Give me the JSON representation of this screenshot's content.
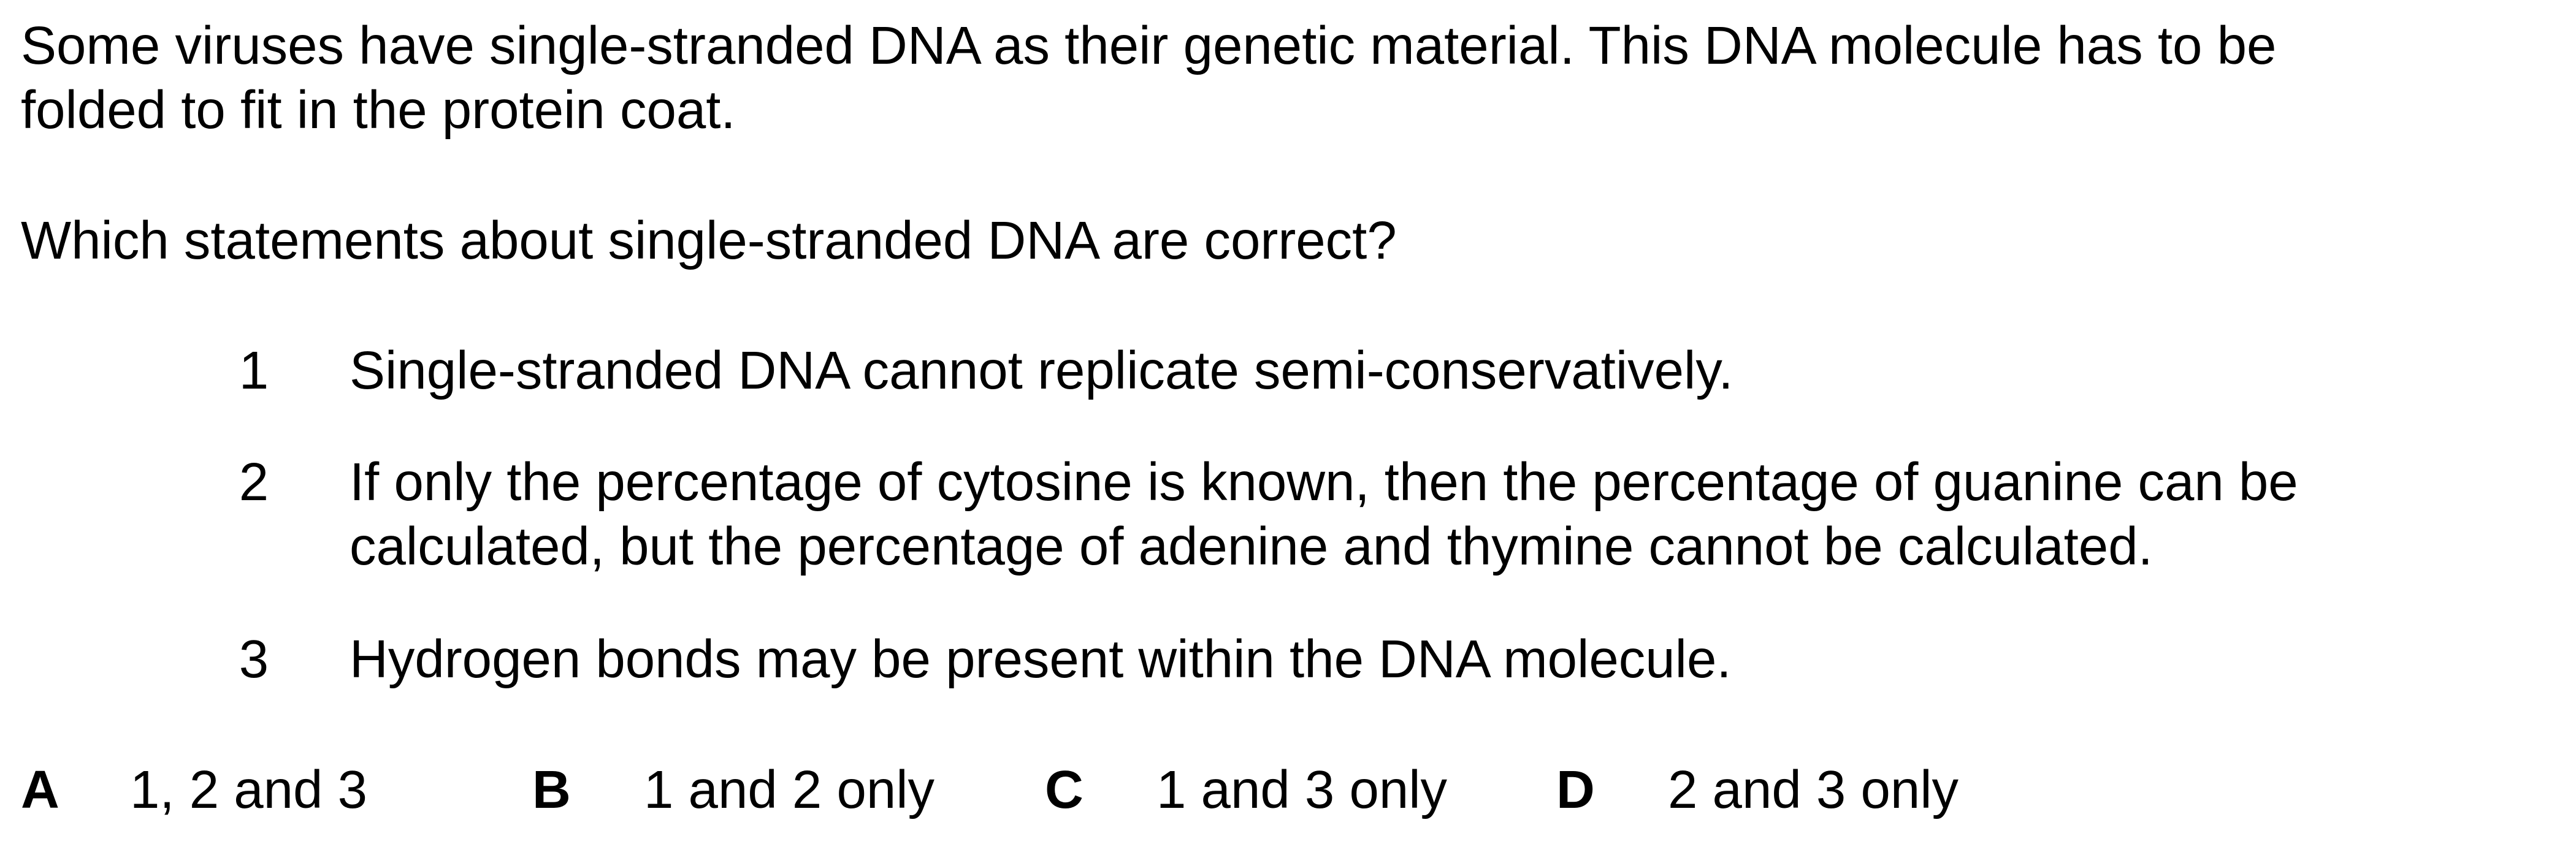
{
  "intro": {
    "line1": "Some viruses have single-stranded DNA as their genetic material. This DNA molecule has to be",
    "line2": "folded to fit in the protein coat."
  },
  "question": "Which statements about single-stranded DNA are correct?",
  "statements": [
    {
      "number": "1",
      "lines": [
        "Single-stranded DNA cannot replicate semi-conservatively."
      ]
    },
    {
      "number": "2",
      "lines": [
        "If only the percentage of cytosine is known, then the percentage of guanine can be",
        "calculated, but the percentage of adenine and thymine cannot be calculated."
      ]
    },
    {
      "number": "3",
      "lines": [
        "Hydrogen bonds may be present within the DNA molecule."
      ]
    }
  ],
  "options": [
    {
      "letter": "A",
      "text": "1, 2 and 3"
    },
    {
      "letter": "B",
      "text": "1 and 2 only"
    },
    {
      "letter": "C",
      "text": "1 and 3 only"
    },
    {
      "letter": "D",
      "text": "2 and 3 only"
    }
  ]
}
